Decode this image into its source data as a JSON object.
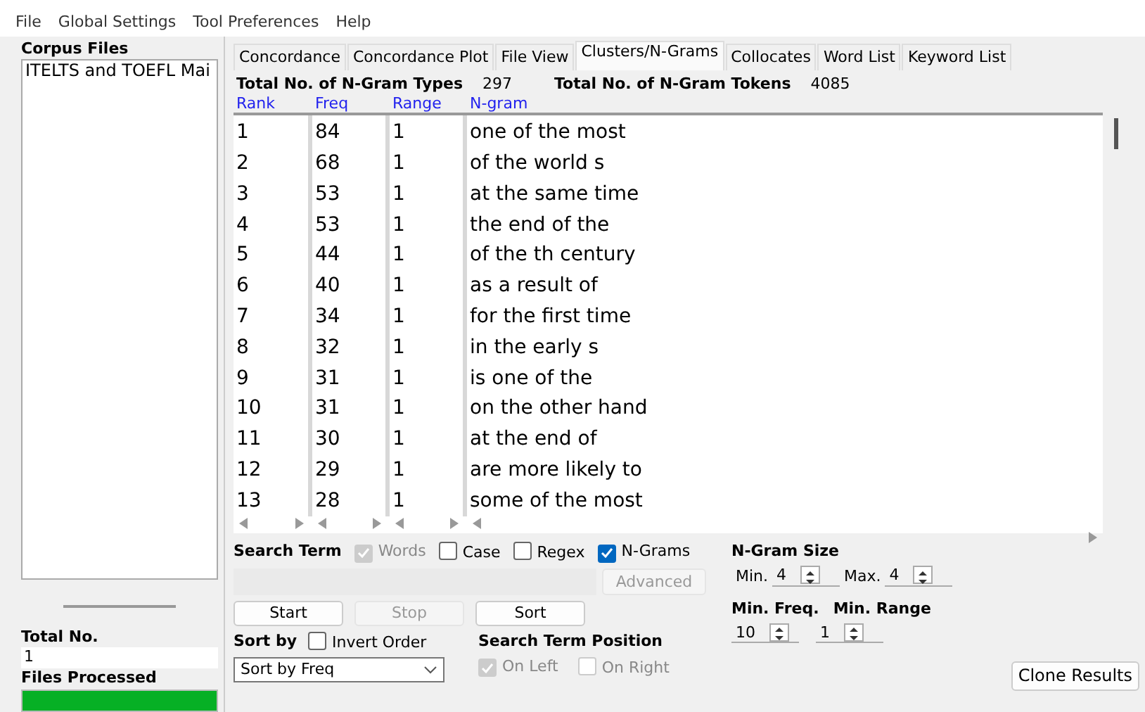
{
  "menu": [
    "File",
    "Global Settings",
    "Tool Preferences",
    "Help"
  ],
  "sidebar": {
    "title": "Corpus Files",
    "files": [
      "ITELTS and TOEFL Mai"
    ],
    "total_label": "Total No.",
    "total_value": "1",
    "progress_label": "Files Processed",
    "level": 1
  },
  "tabs": [
    {
      "label": "Concordance",
      "selected": false
    },
    {
      "label": "Concordance Plot",
      "selected": false
    },
    {
      "label": "File View",
      "selected": false
    },
    {
      "label": "Clusters/N-Grams",
      "selected": true
    },
    {
      "label": "Collocates",
      "selected": false
    },
    {
      "label": "Word List",
      "selected": false
    },
    {
      "label": "Keyword List",
      "selected": false
    }
  ],
  "stats": [
    {
      "label": "Total No. of N-Gram Types",
      "value": "297"
    },
    {
      "label": "Total No. of N-Gram Tokens",
      "value": "4085"
    }
  ],
  "table": {
    "columns": [
      "Rank",
      "Freq",
      "Range",
      "N-gram"
    ],
    "rows": [
      [
        "1",
        "84",
        "1",
        "one of the most"
      ],
      [
        "2",
        "68",
        "1",
        "of the world s"
      ],
      [
        "3",
        "53",
        "1",
        "at the same time"
      ],
      [
        "4",
        "53",
        "1",
        "the end of the"
      ],
      [
        "5",
        "44",
        "1",
        "of the th century"
      ],
      [
        "6",
        "40",
        "1",
        "as a result of"
      ],
      [
        "7",
        "34",
        "1",
        "for the first time"
      ],
      [
        "8",
        "32",
        "1",
        "in the early s"
      ],
      [
        "9",
        "31",
        "1",
        "is one of the"
      ],
      [
        "10",
        "31",
        "1",
        "on the other hand"
      ],
      [
        "11",
        "30",
        "1",
        "at the end of"
      ],
      [
        "12",
        "29",
        "1",
        "are more likely to"
      ],
      [
        "13",
        "28",
        "1",
        "some of the most"
      ]
    ]
  },
  "search_term": {
    "label": "Search Term",
    "options": [
      {
        "label": "Words",
        "checked": true,
        "disabled": true
      },
      {
        "label": "Case",
        "checked": false,
        "disabled": false
      },
      {
        "label": "Regex",
        "checked": false,
        "disabled": false
      },
      {
        "label": "N-Grams",
        "checked": true,
        "disabled": false
      }
    ],
    "advanced": {
      "label": "Advanced",
      "disabled": true
    }
  },
  "buttons": [
    {
      "label": "Start",
      "disabled": false
    },
    {
      "label": "Stop",
      "disabled": true
    },
    {
      "label": "Sort",
      "disabled": false
    }
  ],
  "sort": {
    "label": "Sort by",
    "invert": {
      "label": "Invert Order",
      "checked": false
    },
    "value": "Sort by Freq"
  },
  "position": {
    "label": "Search Term Position",
    "options": [
      {
        "label": "On Left",
        "checked": true,
        "disabled": true
      },
      {
        "label": "On Right",
        "checked": false,
        "disabled": true
      }
    ]
  },
  "ngram_size": {
    "label": "N-Gram Size",
    "min_label": "Min.",
    "min": "4",
    "max_label": "Max.",
    "max": "4"
  },
  "min_freq": {
    "label": "Min. Freq.",
    "value": "10"
  },
  "min_range": {
    "label": "Min. Range",
    "value": "1"
  },
  "clone": "Clone Results"
}
